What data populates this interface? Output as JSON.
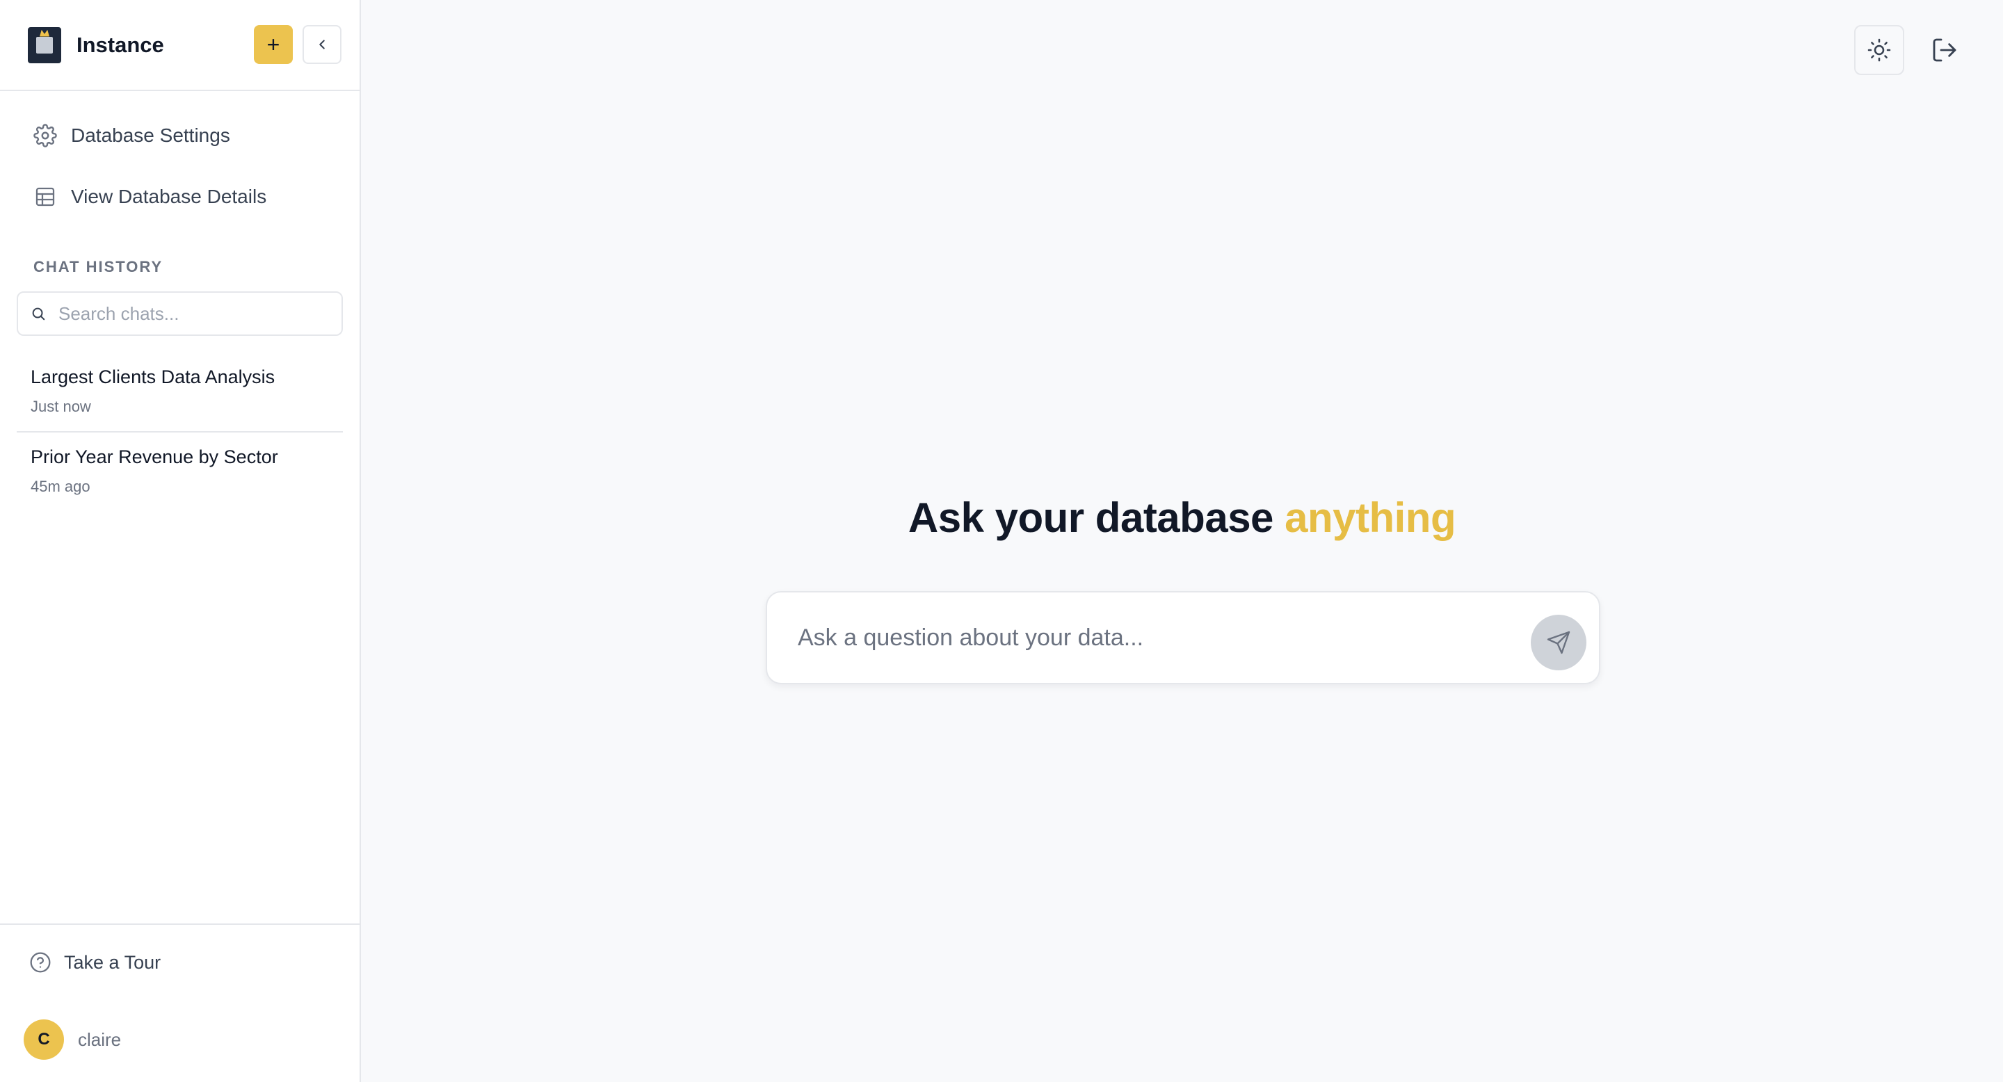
{
  "app": {
    "title": "Instance"
  },
  "header": {
    "new_label": "+"
  },
  "nav": {
    "items": [
      {
        "label": "Database Settings",
        "icon": "gear-icon"
      },
      {
        "label": "View Database Details",
        "icon": "table-icon"
      }
    ]
  },
  "chat_history": {
    "label": "CHAT HISTORY",
    "search_placeholder": "Search chats...",
    "items": [
      {
        "title": "Largest Clients Data Analysis",
        "time": "Just now"
      },
      {
        "title": "Prior Year Revenue by Sector",
        "time": "45m ago"
      }
    ]
  },
  "footer": {
    "tour_label": "Take a Tour",
    "user": {
      "initial": "C",
      "name": "claire"
    }
  },
  "main": {
    "heading_main": "Ask your database ",
    "heading_accent": "anything",
    "input_placeholder": "Ask a question about your data..."
  },
  "colors": {
    "accent": "#ecc34f",
    "heading_accent": "#e6bd45",
    "text": "#111827",
    "muted": "#6b7280",
    "border": "#e5e7eb",
    "background": "#f8f9fb"
  }
}
